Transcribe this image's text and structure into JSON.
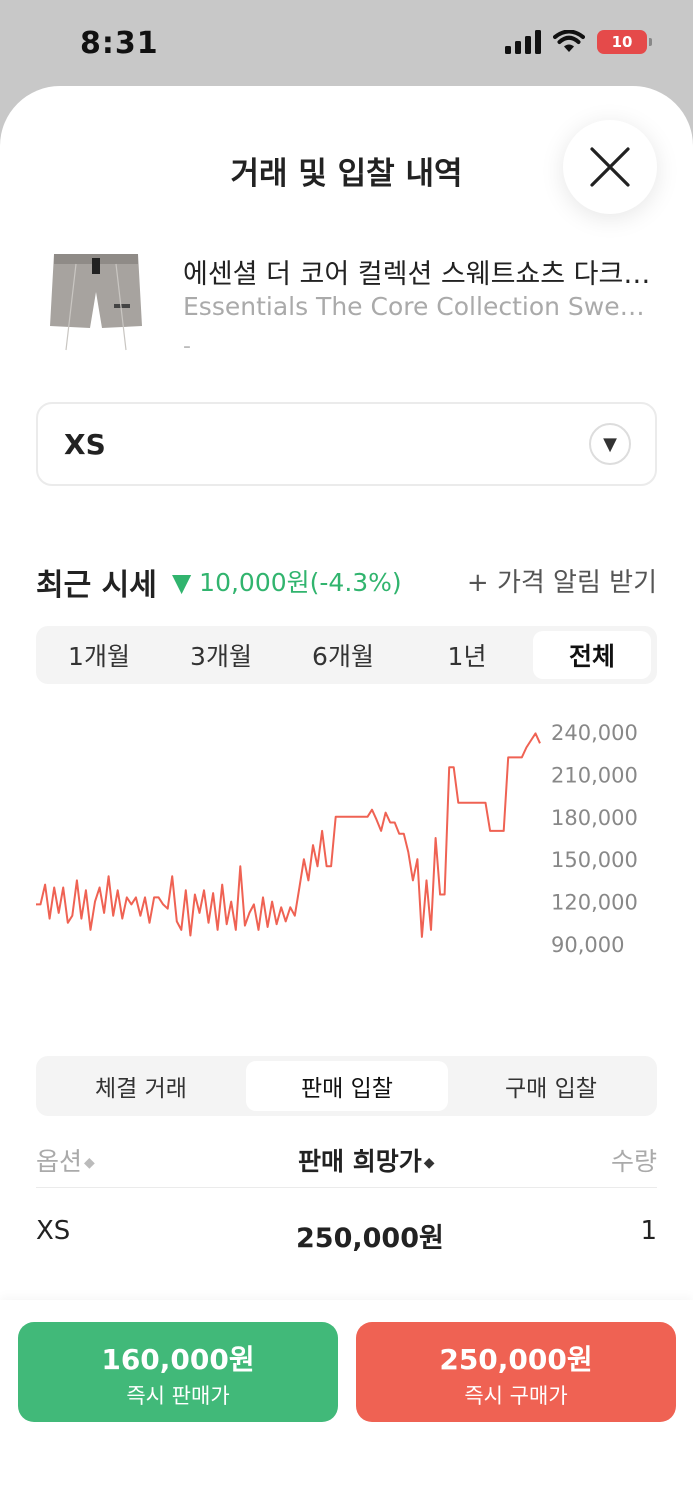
{
  "status_bar": {
    "time": "8:31",
    "battery": "10"
  },
  "sheet": {
    "title": "거래 및 입찰 내역"
  },
  "product": {
    "name_ko": "에센셜 더 코어 컬렉션 스웨트쇼츠 다크 오트밀",
    "name_en": "Essentials The Core Collection Sweatshorts Dark Oatmeal",
    "sub": "-"
  },
  "size_select": {
    "value": "XS"
  },
  "recent_price": {
    "title": "최근 시세",
    "change": "▼ 10,000원(-4.3%)",
    "alert": "+ 가격 알림 받기"
  },
  "period_tabs": [
    {
      "label": "1개월"
    },
    {
      "label": "3개월"
    },
    {
      "label": "6개월"
    },
    {
      "label": "1년"
    },
    {
      "label": "전체"
    }
  ],
  "colors": {
    "line": "#ef6253",
    "sell": "#41b979",
    "buy": "#ef6253",
    "change": "#31b46e"
  },
  "chart_data": {
    "type": "line",
    "title": "",
    "xlabel": "",
    "ylabel": "",
    "ylim": [
      90000,
      240000
    ],
    "y_ticks": [
      "240,000",
      "210,000",
      "180,000",
      "150,000",
      "120,000",
      "90,000"
    ],
    "y_tick_values": [
      240000,
      210000,
      180000,
      150000,
      120000,
      90000
    ],
    "grid": false,
    "series": [
      {
        "values": [
          118000,
          118000,
          132000,
          108000,
          130000,
          112000,
          130000,
          105000,
          110000,
          135000,
          108000,
          128000,
          100000,
          120000,
          130000,
          112000,
          138000,
          110000,
          128000,
          108000,
          123000,
          118000,
          123000,
          110000,
          123000,
          105000,
          123000,
          123000,
          118000,
          115000,
          138000,
          106000,
          100000,
          128000,
          96000,
          125000,
          112000,
          128000,
          105000,
          126000,
          100000,
          132000,
          104000,
          120000,
          100000,
          145000,
          103000,
          112000,
          118000,
          100000,
          123000,
          102000,
          120000,
          104000,
          116000,
          106000,
          116000,
          110000,
          130000,
          150000,
          135000,
          160000,
          145000,
          170000,
          145000,
          145000,
          180000,
          180000,
          180000,
          180000,
          180000,
          180000,
          180000,
          180000,
          185000,
          178000,
          170000,
          183000,
          176000,
          176000,
          168000,
          168000,
          155000,
          135000,
          150000,
          95000,
          135000,
          100000,
          165000,
          125000,
          125000,
          215000,
          215000,
          190000,
          190000,
          190000,
          190000,
          190000,
          190000,
          190000,
          170000,
          170000,
          170000,
          170000,
          222000,
          222000,
          222000,
          222000,
          229000,
          234000,
          239000,
          232000
        ]
      }
    ]
  },
  "bid_tabs": [
    {
      "label": "체결 거래"
    },
    {
      "label": "판매 입찰"
    },
    {
      "label": "구매 입찰"
    }
  ],
  "table": {
    "headers": {
      "option": "옵션",
      "price": "판매 희망가",
      "qty": "수량"
    },
    "rows": [
      {
        "option": "XS",
        "price": "250,000원",
        "qty": "1"
      }
    ]
  },
  "footer": {
    "sell_price": "160,000원",
    "sell_label": "즉시 판매가",
    "buy_price": "250,000원",
    "buy_label": "즉시 구매가"
  }
}
